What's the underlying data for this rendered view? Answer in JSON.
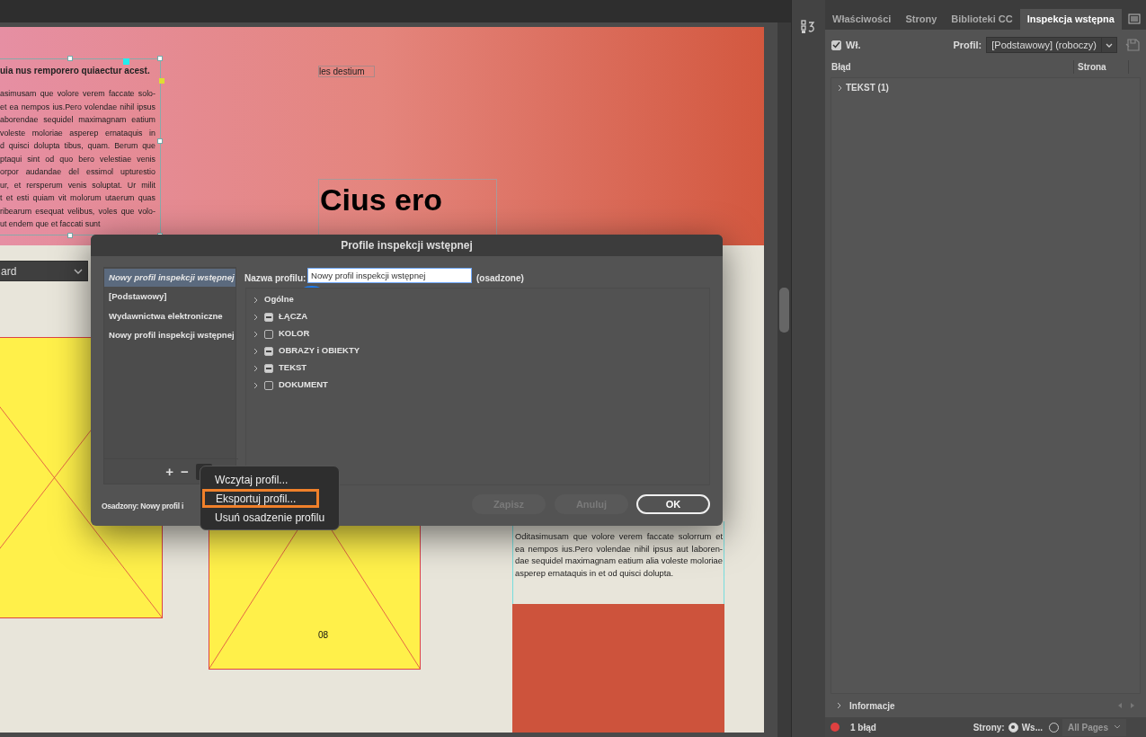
{
  "document": {
    "heading": "uia nus remporero quiaectur acest.",
    "paragraph_lines": [
      "asimusam que volore verem faccate solo-",
      "et ea nempos ius.Pero volendae nihil ipsus",
      "aborendae sequidel maximagnam eatium",
      "voleste moloriae asperep ernataquis in",
      "d quisci dolupta tibus, quam. Berum que",
      "ptaqui sint od quo bero velestiae venis",
      "orpor audandae del essimol upturestio",
      "ur, et rersperum venis soluptat. Ur milit",
      "t et esti quiam vit molorum utaerum quas",
      "ribearum esequat velibus, voles que volo-",
      "ut endem que et faccati sunt"
    ],
    "caption": "les destium",
    "title": "Cius ero",
    "dropdown_value": "ard",
    "column_lines": [
      "Oditasimusam que volore verem faccate solorrum et",
      "ea nempos ius.Pero volendae nihil ipsus aut laboren-",
      "dae sequidel maximagnam eatium alia voleste moloriae",
      "asperep ernataquis in et od quisci dolupta."
    ],
    "page_number": "08"
  },
  "dialog": {
    "title": "Profile inspekcji wstępnej",
    "profiles": [
      {
        "label": "Nowy profil inspekcji wstępnej",
        "selected": true
      },
      {
        "label": "[Podstawowy]",
        "selected": false
      },
      {
        "label": "Wydawnictwa elektroniczne",
        "selected": false
      },
      {
        "label": "Nowy profil inspekcji wstępnej",
        "selected": false
      }
    ],
    "name_label": "Nazwa profilu:",
    "name_value": "Nowy profil inspekcji wstępnej",
    "name_note": "(osadzone)",
    "categories": [
      {
        "label": "Ogólne",
        "kind": "plain"
      },
      {
        "label": "ŁĄCZA",
        "kind": "check",
        "mixed": true
      },
      {
        "label": "KOLOR",
        "kind": "check",
        "mixed": false
      },
      {
        "label": "OBRAZY i OBIEKTY",
        "kind": "check",
        "mixed": true
      },
      {
        "label": "TEKST",
        "kind": "check",
        "mixed": true
      },
      {
        "label": "DOKUMENT",
        "kind": "check",
        "mixed": false
      }
    ],
    "list_buttons": [
      "+",
      "−"
    ],
    "embedded_label": "Osadzony: Nowy profil i",
    "buttons": [
      {
        "label": "Zapisz",
        "disabled": true,
        "default": false
      },
      {
        "label": "Anuluj",
        "disabled": true,
        "default": false
      },
      {
        "label": "OK",
        "disabled": false,
        "default": true
      }
    ]
  },
  "menu": {
    "items": [
      {
        "label": "Wczytaj profil...",
        "highlighted": false
      },
      {
        "label": "Eksportuj profil...",
        "highlighted": true
      },
      {
        "label": "Usuń osadzenie profilu",
        "highlighted": false
      }
    ]
  },
  "panel": {
    "tabs": [
      {
        "label": "Właściwości",
        "selected": false
      },
      {
        "label": "Strony",
        "selected": false
      },
      {
        "label": "Biblioteki CC",
        "selected": false
      },
      {
        "label": "Inspekcja wstępna",
        "selected": true
      }
    ],
    "on_label": "Wł.",
    "on_checked": true,
    "profile_label": "Profil:",
    "profile_value": "[Podstawowy] (roboczy)",
    "columns": [
      "Błąd",
      "Strona"
    ],
    "rows": [
      {
        "label": "TEKST (1)",
        "expanded": false
      }
    ],
    "info_label": "Informacje",
    "status": "1 błąd",
    "pages_label": "Strony:",
    "page_options": [
      {
        "label": "Ws...",
        "selected": true
      },
      {
        "selected": false
      }
    ],
    "pages_select": "All Pages"
  }
}
